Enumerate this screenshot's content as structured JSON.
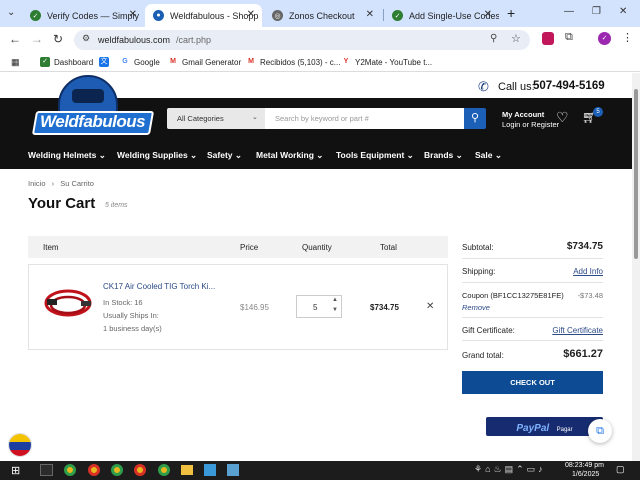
{
  "browser": {
    "tabs": [
      {
        "title": "Verify Codes — Simply",
        "icon": "checkmark-favicon",
        "color": "#2e7d32"
      },
      {
        "title": "Weldfabulous - Shopp",
        "icon": "globe-favicon",
        "color": "#1a5fb4"
      },
      {
        "title": "Zonos Checkout",
        "icon": "zonos-favicon",
        "color": "#555555"
      },
      {
        "title": "Add Single-Use Codes",
        "icon": "checkmark-favicon",
        "color": "#2e7d32"
      }
    ],
    "new_tab": "+",
    "url_host": "weldfabulous.com",
    "url_path": "/cart.php",
    "bookmarks": [
      {
        "label": "Dashboard",
        "icon": "checkmark-favicon"
      },
      {
        "label": "",
        "icon": "translate-favicon"
      },
      {
        "label": "Google",
        "icon": "google-favicon"
      },
      {
        "label": "Gmail Generator",
        "icon": "gmail-favicon"
      },
      {
        "label": "Recibidos (5,103) - c...",
        "icon": "gmail-favicon"
      },
      {
        "label": "Y2Mate - YouTube t...",
        "icon": "y2mate-favicon"
      }
    ]
  },
  "site": {
    "phone_label": "Call us:",
    "phone": "507-494-5169",
    "logo": "Weldfabulous",
    "category_select": "All Categories",
    "search_placeholder": "Search by keyword or part #",
    "account_title": "My Account",
    "account_sub": "Login or Register",
    "cart_count": "5",
    "nav": [
      "Welding Helmets",
      "Welding Supplies",
      "Safety",
      "Metal Working",
      "Tools Equipment",
      "Brands",
      "Sale"
    ]
  },
  "cart": {
    "breadcrumb": [
      "Inicio",
      "Su Carrito"
    ],
    "title": "Your Cart",
    "items_count": "5 items",
    "headers": {
      "item": "Item",
      "price": "Price",
      "quantity": "Quantity",
      "total": "Total"
    },
    "item": {
      "name": "CK17 Air Cooled TIG Torch Ki...",
      "stock": "In Stock: 16",
      "ships": "Usually Ships In:",
      "ships_time": "1 business day(s)",
      "price": "$146.95",
      "qty": "5",
      "total": "$734.75",
      "remove": "✕"
    },
    "summary": {
      "subtotal_label": "Subtotal:",
      "subtotal": "$734.75",
      "shipping_label": "Shipping:",
      "shipping_link": "Add Info",
      "coupon_label": "Coupon (BF1CC13275E81FE)",
      "coupon_value": "-$73.48",
      "coupon_remove": "Remove",
      "gift_label": "Gift Certificate:",
      "gift_link": "Gift Certificate",
      "grand_label": "Grand total:",
      "grand": "$661.27",
      "checkout": "CHECK OUT",
      "paypal": "PayPal",
      "paypal_sub": "Pagar"
    }
  },
  "taskbar": {
    "time": "08:23:49 pm",
    "date": "1/6/2025"
  }
}
